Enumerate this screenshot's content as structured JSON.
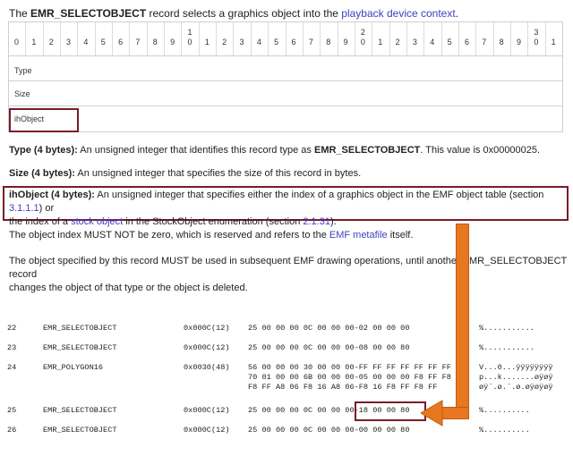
{
  "intro": {
    "prefix": "The ",
    "record_name": "EMR_SELECTOBJECT",
    "middle": " record selects a graphics object into the ",
    "link": "playback device context",
    "suffix": "."
  },
  "bit_table": {
    "bits": [
      "0",
      "1",
      "2",
      "3",
      "4",
      "5",
      "6",
      "7",
      "8",
      "9",
      "1\n0",
      "1",
      "2",
      "3",
      "4",
      "5",
      "6",
      "7",
      "8",
      "9",
      "2\n0",
      "1",
      "2",
      "3",
      "4",
      "5",
      "6",
      "7",
      "8",
      "9",
      "3\n0",
      "1"
    ],
    "fields": [
      "Type",
      "Size",
      "ihObject"
    ]
  },
  "definitions": {
    "type": {
      "term": "Type (4 bytes):",
      "text1": " An unsigned integer that identifies this record type as ",
      "strong": "EMR_SELECTOBJECT",
      "text2": ". This value is 0x00000025."
    },
    "size": {
      "term": "Size (4 bytes):",
      "text": " An unsigned integer that specifies the size of this record in bytes."
    },
    "ihobject": {
      "term": "ihObject (4 bytes):",
      "text1": " An unsigned integer that specifies either the index of a graphics object in the EMF object table (section ",
      "link1": "3.1.1.1",
      "text2": ") or",
      "text3": "the index of a ",
      "link2": "stock object",
      "text4": " in the StockObject enumeration (section ",
      "link3": "2.1.31",
      "text5": ")."
    }
  },
  "notes": {
    "note1_a": "The object index MUST NOT be zero, which is reserved and refers to the ",
    "note1_link": "EMF metafile",
    "note1_b": " itself.",
    "note2_line1": "The object specified by this record MUST be used in subsequent EMF drawing operations, until another EMR_SELECTOBJECT record",
    "note2_line2": "changes the object of that type or the object is deleted."
  },
  "dump_rows": [
    {
      "num": "22",
      "name": "EMR_SELECTOBJECT",
      "size": "0x000C(12)",
      "hex": [
        "25 00 00 00 0C 00 00 00-02 00 00 00"
      ],
      "ascii": [
        "%..........."
      ]
    },
    {
      "num": "23",
      "name": "EMR_SELECTOBJECT",
      "size": "0x000C(12)",
      "hex": [
        "25 00 00 00 0C 00 00 00-08 00 00 80"
      ],
      "ascii": [
        "%..........."
      ]
    },
    {
      "num": "24",
      "name": "EMR_POLYGON16",
      "size": "0x0030(48)",
      "hex": [
        "56 00 00 00 30 00 00 00-FF FF FF FF FF FF FF",
        "70 01 00 00 6B 00 00 00-05 00 00 00 F8 FF F8",
        "F8 FF A8 06 F8 16 A8 06-F8 16 F8 FF F8 FF"
      ],
      "ascii": [
        "V...0...ÿÿÿÿÿÿÿÿ",
        "p...k.......øÿøÿ",
        "øÿ¨.ø.¨.ø.øÿøÿøÿ"
      ]
    },
    {
      "num": "25",
      "name": "EMR_SELECTOBJECT",
      "size": "0x000C(12)",
      "hex": [
        "25 00 00 00 0C 00 00 00-18 00 00 80"
      ],
      "ascii": [
        "%.........."
      ]
    },
    {
      "num": "26",
      "name": "EMR_SELECTOBJECT",
      "size": "0x000C(12)",
      "hex": [
        "25 00 00 00 0C 00 00 00-00 00 00 80"
      ],
      "ascii": [
        "%.........."
      ]
    }
  ],
  "colors": {
    "highlight_box": "#7a1b2b",
    "arrow": "#e87722",
    "link": "#4040c0"
  }
}
